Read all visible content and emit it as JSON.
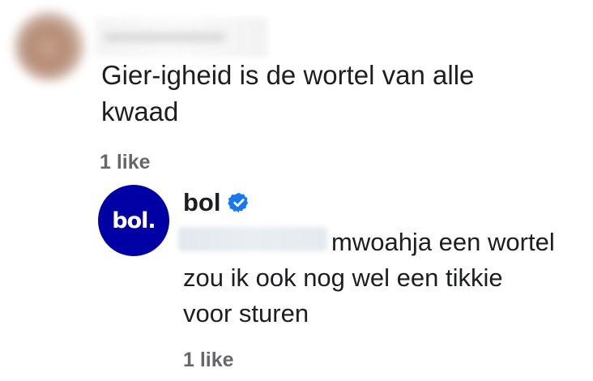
{
  "comment": {
    "text": "Gier-igheid is de wortel van alle\nkwaad",
    "likes": "1 like"
  },
  "reply": {
    "author": "bol",
    "avatar_text": "bol.",
    "verified_icon": "verified-badge-icon",
    "text_line1": "mwoahja een wortel",
    "text_rest": "zou ik ook nog wel een tikkie\nvoor sturen",
    "likes": "1 like"
  },
  "colors": {
    "text": "#1c1e21",
    "muted": "#65676b",
    "bol_blue": "#0000a4",
    "verified_blue": "#1877f2"
  }
}
